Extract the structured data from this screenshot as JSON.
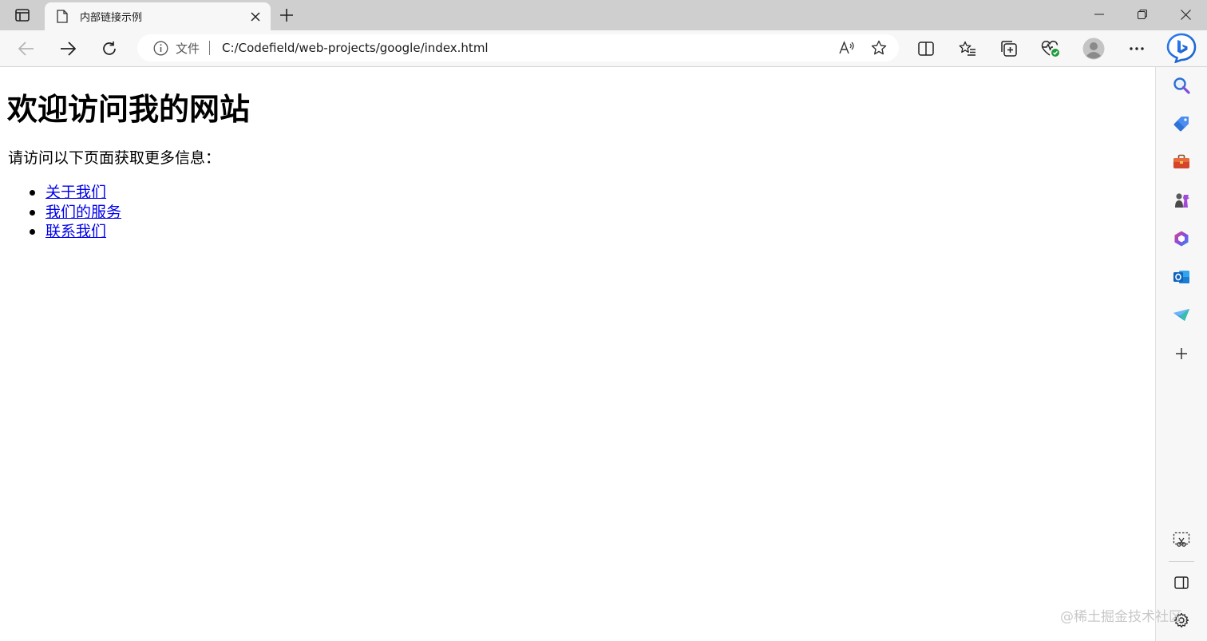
{
  "tab": {
    "title": "内部链接示例"
  },
  "address_bar": {
    "scheme_label": "文件",
    "url": "C:/Codefield/web-projects/google/index.html"
  },
  "page": {
    "heading": "欢迎访问我的网站",
    "intro": "请访问以下页面获取更多信息：",
    "links": [
      "关于我们",
      "我们的服务",
      "联系我们"
    ]
  },
  "watermark": "@稀土掘金技术社区",
  "colors": {
    "link": "#0000ee",
    "tabbar_bg": "#cfcfcf",
    "toolbar_bg": "#f7f7f7"
  },
  "icons": {
    "tab_actions": "tab-actions-icon",
    "favicon": "document-icon",
    "close": "close-icon",
    "new_tab": "plus-icon",
    "back": "back-arrow-icon",
    "forward": "forward-arrow-icon",
    "refresh": "refresh-icon",
    "info": "info-icon",
    "read_aloud": "read-aloud-icon",
    "favorite": "star-icon",
    "split_screen": "split-screen-icon",
    "favorites": "favorites-list-icon",
    "collections": "collections-icon",
    "browser_essentials": "heart-pulse-icon",
    "profile": "profile-avatar-icon",
    "more": "more-dots-icon",
    "bing": "bing-chat-icon",
    "sidebar": [
      "search-icon",
      "shopping-tag-icon",
      "tools-briefcase-icon",
      "games-icon",
      "microsoft-365-icon",
      "outlook-icon",
      "drop-send-icon",
      "add-icon",
      "screenshot-icon",
      "sidebar-toggle-icon",
      "settings-gear-icon"
    ]
  }
}
